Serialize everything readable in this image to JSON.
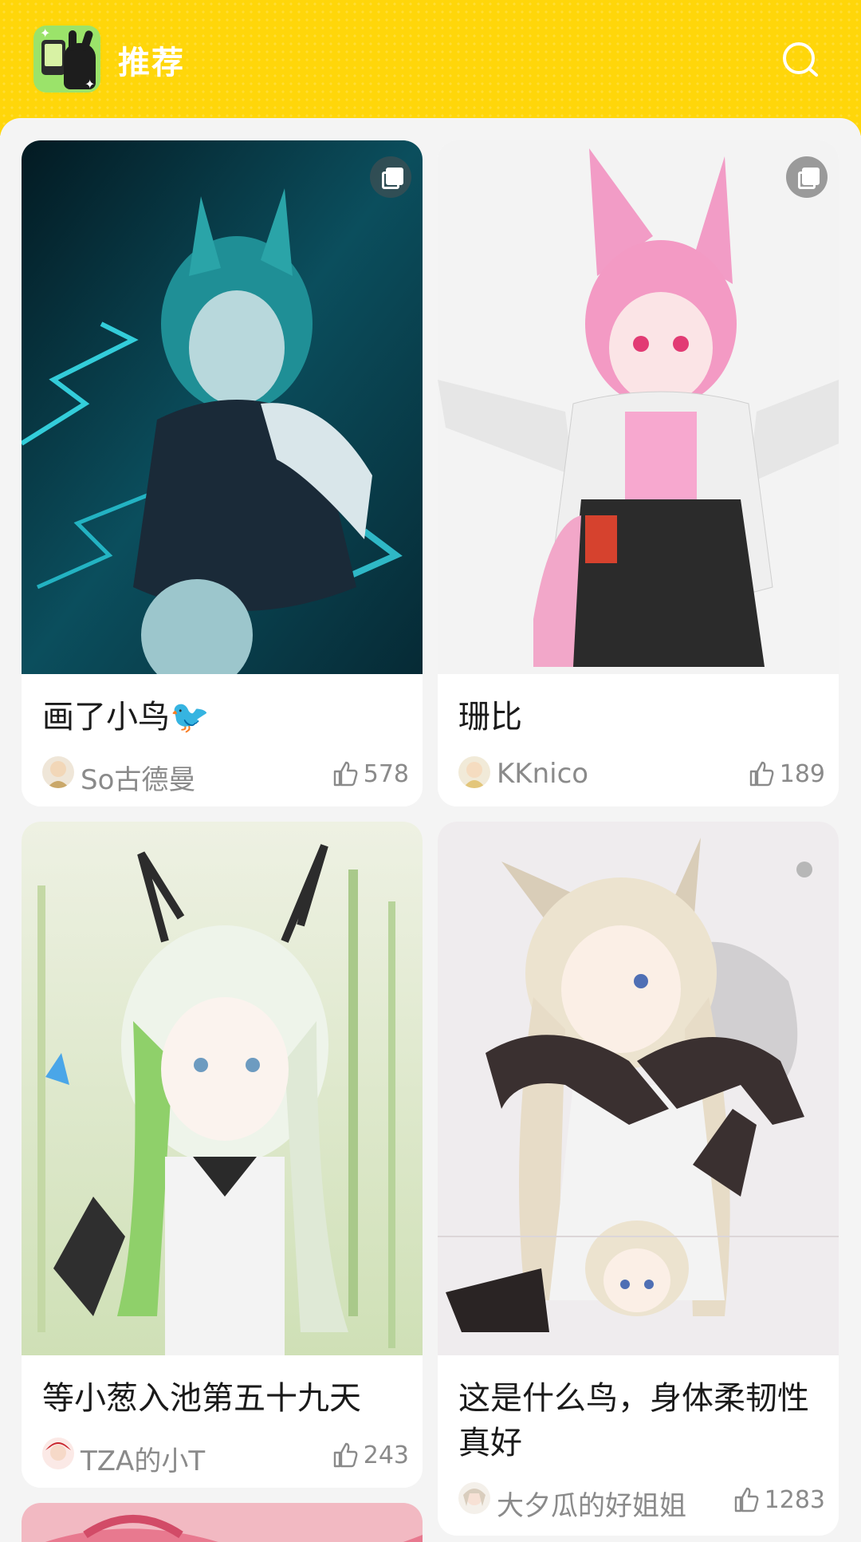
{
  "header": {
    "title": "推荐",
    "logo_icon": "app-logo-icon",
    "search_icon": "search-icon",
    "accent": "#ffd60a"
  },
  "feed": {
    "posts": [
      {
        "title": "画了小鸟🐦",
        "author": "So古德曼",
        "likes": "578",
        "multi_image": true,
        "palette": [
          "#062a35",
          "#14c6d8"
        ]
      },
      {
        "title": "珊比",
        "author": "KKnico",
        "likes": "189",
        "multi_image": true,
        "palette": [
          "#f2f2f2",
          "#f58ec0"
        ]
      },
      {
        "title": "等小葱入池第五十九天",
        "author": "TZA的小T",
        "likes": "243",
        "multi_image": false,
        "palette": [
          "#dfe9cf",
          "#7fbf65"
        ]
      },
      {
        "title": "这是什么鸟，身体柔韧性真好",
        "author": "大夕瓜的好姐姐",
        "likes": "1283",
        "multi_image": false,
        "palette": [
          "#eeeaec",
          "#3a3030"
        ]
      }
    ]
  }
}
